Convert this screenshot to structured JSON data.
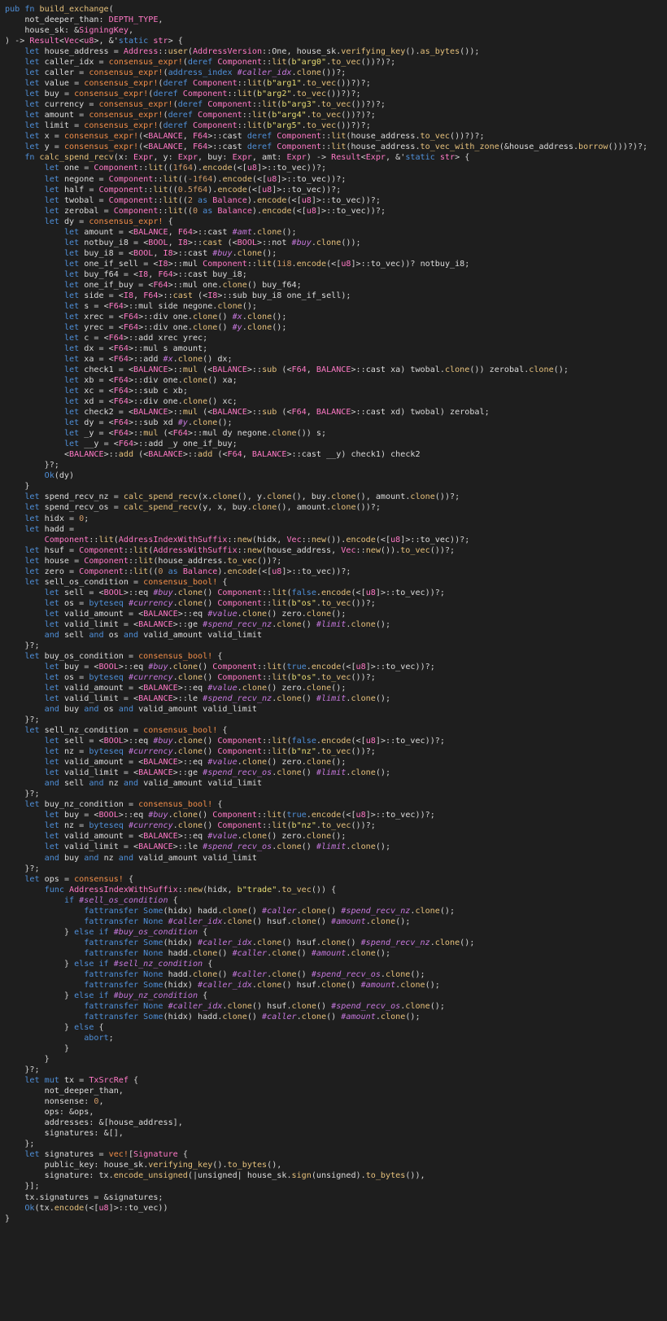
{
  "editor": {
    "theme": {
      "background": "#1e1e1e",
      "text": "#d4d4d4",
      "keyword": "#4f8fd8",
      "function": "#e5c07b",
      "type": "#ff79c6",
      "string": "#e6db74",
      "number": "#d19a66",
      "macro": "#f08d49",
      "interpolation": "#c678dd"
    },
    "lines": [
      "pub fn build_exchange(",
      "    not_deeper_than: DEPTH_TYPE,",
      "    house_sk: &SigningKey,",
      ") -> Result<Vec<u8>, &'static str> {",
      "    let house_address = Address::user(AddressVersion::One, house_sk.verifying_key().as_bytes());",
      "    let caller_idx = consensus_expr!(deref Component::lit(b\"arg0\".to_vec())?)?;",
      "    let caller = consensus_expr!(address_index #caller_idx.clone())?;",
      "    let value = consensus_expr!(deref Component::lit(b\"arg1\".to_vec())?)?;",
      "    let buy = consensus_expr!(deref Component::lit(b\"arg2\".to_vec())?)?;",
      "    let currency = consensus_expr!(deref Component::lit(b\"arg3\".to_vec())?)?;",
      "    let amount = consensus_expr!(deref Component::lit(b\"arg4\".to_vec())?)?;",
      "    let limit = consensus_expr!(deref Component::lit(b\"arg5\".to_vec())?)?;",
      "    let x = consensus_expr!(<BALANCE, F64>::cast deref Component::lit(house_address.to_vec())?)?;",
      "    let y = consensus_expr!(<BALANCE, F64>::cast deref Component::lit(house_address.to_vec_with_zone(&house_address.borrow()))?)?;",
      "    fn calc_spend_recv(x: Expr, y: Expr, buy: Expr, amt: Expr) -> Result<Expr, &'static str> {",
      "        let one = Component::lit((1f64).encode(<[u8]>::to_vec))?;",
      "        let negone = Component::lit((-1f64).encode(<[u8]>::to_vec))?;",
      "        let half = Component::lit((0.5f64).encode(<[u8]>::to_vec))?;",
      "        let twobal = Component::lit((2 as Balance).encode(<[u8]>::to_vec))?;",
      "        let zerobal = Component::lit((0 as Balance).encode(<[u8]>::to_vec))?;",
      "        let dy = consensus_expr! {",
      "            let amount = <BALANCE, F64>::cast #amt.clone();",
      "            let notbuy_i8 = <BOOL, I8>::cast (<BOOL>::not #buy.clone());",
      "            let buy_i8 = <BOOL, I8>::cast #buy.clone();",
      "            let one_if_sell = <I8>::mul Component::lit(1i8.encode(<[u8]>::to_vec))? notbuy_i8;",
      "            let buy_f64 = <I8, F64>::cast buy_i8;",
      "            let one_if_buy = <F64>::mul one.clone() buy_f64;",
      "            let side = <I8, F64>::cast (<I8>::sub buy_i8 one_if_sell);",
      "            let s = <F64>::mul side negone.clone();",
      "            let xrec = <F64>::div one.clone() #x.clone();",
      "            let yrec = <F64>::div one.clone() #y.clone();",
      "            let c = <F64>::add xrec yrec;",
      "            let dx = <F64>::mul s amount;",
      "            let xa = <F64>::add #x.clone() dx;",
      "            let check1 = <BALANCE>::mul (<BALANCE>::sub (<F64, BALANCE>::cast xa) twobal.clone()) zerobal.clone();",
      "            let xb = <F64>::div one.clone() xa;",
      "            let xc = <F64>::sub c xb;",
      "            let xd = <F64>::div one.clone() xc;",
      "            let check2 = <BALANCE>::mul (<BALANCE>::sub (<F64, BALANCE>::cast xd) twobal) zerobal;",
      "            let dy = <F64>::sub xd #y.clone();",
      "            let _y = <F64>::mul (<F64>::mul dy negone.clone()) s;",
      "            let __y = <F64>::add _y one_if_buy;",
      "            <BALANCE>::add (<BALANCE>::add (<F64, BALANCE>::cast __y) check1) check2",
      "        }?;",
      "        Ok(dy)",
      "    }",
      "    let spend_recv_nz = calc_spend_recv(x.clone(), y.clone(), buy.clone(), amount.clone())?;",
      "    let spend_recv_os = calc_spend_recv(y, x, buy.clone(), amount.clone())?;",
      "    let hidx = 0;",
      "    let hadd =",
      "        Component::lit(AddressIndexWithSuffix::new(hidx, Vec::new()).encode(<[u8]>::to_vec))?;",
      "    let hsuf = Component::lit(AddressWithSuffix::new(house_address, Vec::new()).to_vec())?;",
      "    let house = Component::lit(house_address.to_vec())?;",
      "    let zero = Component::lit((0 as Balance).encode(<[u8]>::to_vec))?;",
      "    let sell_os_condition = consensus_bool! {",
      "        let sell = <BOOL>::eq #buy.clone() Component::lit(false.encode(<[u8]>::to_vec))?;",
      "        let os = byteseq #currency.clone() Component::lit(b\"os\".to_vec())?;",
      "        let valid_amount = <BALANCE>::eq #value.clone() zero.clone();",
      "        let valid_limit = <BALANCE>::ge #spend_recv_nz.clone() #limit.clone();",
      "        and sell and os and valid_amount valid_limit",
      "    }?;",
      "    let buy_os_condition = consensus_bool! {",
      "        let buy = <BOOL>::eq #buy.clone() Component::lit(true.encode(<[u8]>::to_vec))?;",
      "        let os = byteseq #currency.clone() Component::lit(b\"os\".to_vec())?;",
      "        let valid_amount = <BALANCE>::eq #value.clone() zero.clone();",
      "        let valid_limit = <BALANCE>::le #spend_recv_nz.clone() #limit.clone();",
      "        and buy and os and valid_amount valid_limit",
      "    }?;",
      "    let sell_nz_condition = consensus_bool! {",
      "        let sell = <BOOL>::eq #buy.clone() Component::lit(false.encode(<[u8]>::to_vec))?;",
      "        let nz = byteseq #currency.clone() Component::lit(b\"nz\".to_vec())?;",
      "        let valid_amount = <BALANCE>::eq #value.clone() zero.clone();",
      "        let valid_limit = <BALANCE>::ge #spend_recv_os.clone() #limit.clone();",
      "        and sell and nz and valid_amount valid_limit",
      "    }?;",
      "    let buy_nz_condition = consensus_bool! {",
      "        let buy = <BOOL>::eq #buy.clone() Component::lit(true.encode(<[u8]>::to_vec))?;",
      "        let nz = byteseq #currency.clone() Component::lit(b\"nz\".to_vec())?;",
      "        let valid_amount = <BALANCE>::eq #value.clone() zero.clone();",
      "        let valid_limit = <BALANCE>::le #spend_recv_os.clone() #limit.clone();",
      "        and buy and nz and valid_amount valid_limit",
      "    }?;",
      "    let ops = consensus! {",
      "        func AddressIndexWithSuffix::new(hidx, b\"trade\".to_vec()) {",
      "            if #sell_os_condition {",
      "                fattransfer Some(hidx) hadd.clone() #caller.clone() #spend_recv_nz.clone();",
      "                fattransfer None #caller_idx.clone() hsuf.clone() #amount.clone();",
      "            } else if #buy_os_condition {",
      "                fattransfer Some(hidx) #caller_idx.clone() hsuf.clone() #spend_recv_nz.clone();",
      "                fattransfer None hadd.clone() #caller.clone() #amount.clone();",
      "            } else if #sell_nz_condition {",
      "                fattransfer None hadd.clone() #caller.clone() #spend_recv_os.clone();",
      "                fattransfer Some(hidx) #caller_idx.clone() hsuf.clone() #amount.clone();",
      "            } else if #buy_nz_condition {",
      "                fattransfer None #caller_idx.clone() hsuf.clone() #spend_recv_os.clone();",
      "                fattransfer Some(hidx) hadd.clone() #caller.clone() #amount.clone();",
      "            } else {",
      "                abort;",
      "            }",
      "        }",
      "    }?;",
      "    let mut tx = TxSrcRef {",
      "        not_deeper_than,",
      "        nonsense: 0,",
      "        ops: &ops,",
      "        addresses: &[house_address],",
      "        signatures: &[],",
      "    };",
      "    let signatures = vec![Signature {",
      "        public_key: house_sk.verifying_key().to_bytes(),",
      "        signature: tx.encode_unsigned(|unsigned| house_sk.sign(unsigned).to_bytes()),",
      "    }];",
      "    tx.signatures = &signatures;",
      "    Ok(tx.encode(<[u8]>::to_vec))",
      "}"
    ]
  }
}
